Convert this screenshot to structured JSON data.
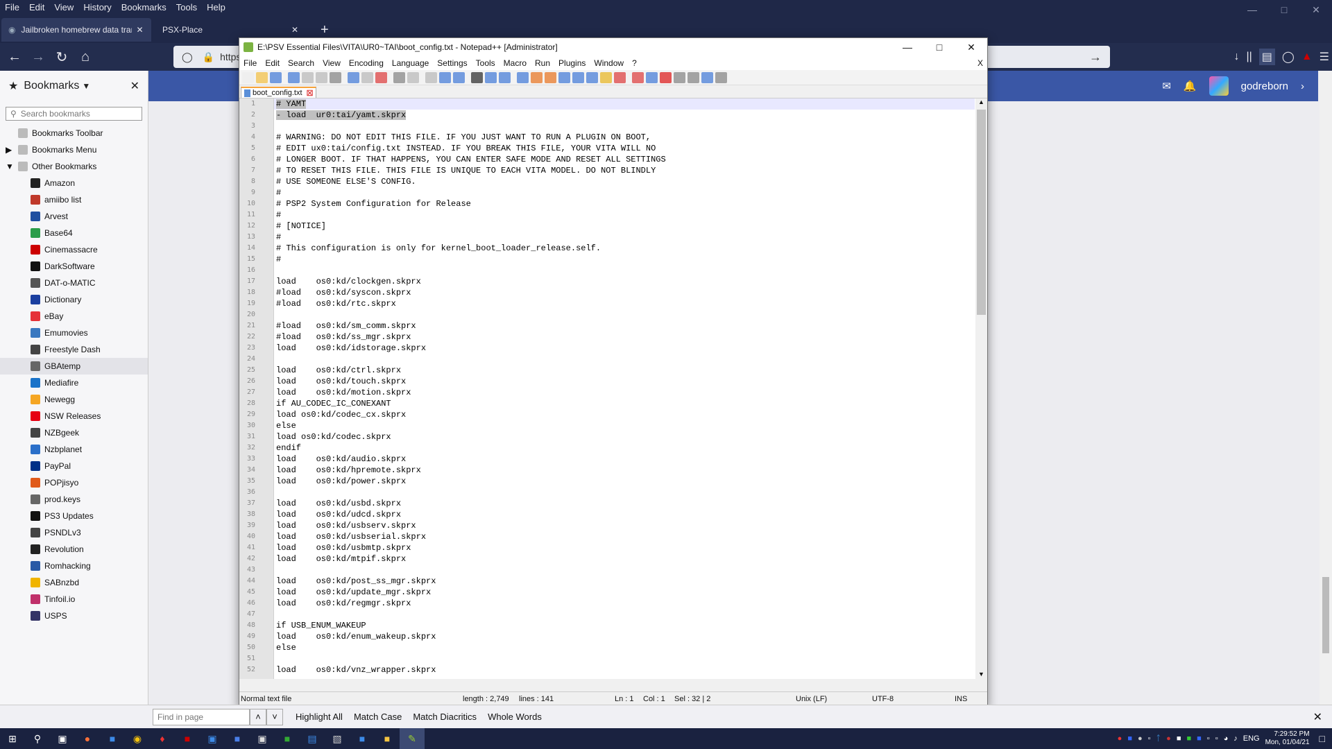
{
  "firefox": {
    "menu": [
      "File",
      "Edit",
      "View",
      "History",
      "Bookmarks",
      "Tools",
      "Help"
    ],
    "tabs": [
      {
        "title": "Jailbroken homebrew data tran",
        "active": true
      },
      {
        "title": "PSX-Place",
        "active": false
      }
    ],
    "url": "https",
    "findbar": {
      "placeholder": "Find in page",
      "highlight_all": "Highlight All",
      "match_case": "Match Case",
      "match_diacritics": "Match Diacritics",
      "whole_words": "Whole Words"
    },
    "site": {
      "username": "godreborn",
      "accent": "#3a57a6"
    }
  },
  "sidebar": {
    "title": "Bookmarks",
    "search_placeholder": "Search bookmarks",
    "folders": [
      "Bookmarks Toolbar",
      "Bookmarks Menu",
      "Other Bookmarks"
    ],
    "items": [
      {
        "label": "Amazon",
        "icon": "amazon-icon",
        "color": "#222"
      },
      {
        "label": "amiibo list",
        "icon": "amiibo-icon",
        "color": "#c0392b"
      },
      {
        "label": "Arvest",
        "icon": "arvest-icon",
        "color": "#1f4fa0"
      },
      {
        "label": "Base64",
        "icon": "base64-icon",
        "color": "#2a9d4a"
      },
      {
        "label": "Cinemassacre",
        "icon": "cinemassacre-icon",
        "color": "#c00"
      },
      {
        "label": "DarkSoftware",
        "icon": "darksoftware-icon",
        "color": "#111"
      },
      {
        "label": "DAT-o-MATIC",
        "icon": "datomatic-icon",
        "color": "#555"
      },
      {
        "label": "Dictionary",
        "icon": "dictionary-icon",
        "color": "#1b3fa0"
      },
      {
        "label": "eBay",
        "icon": "ebay-icon",
        "color": "#e53238"
      },
      {
        "label": "Emumovies",
        "icon": "emumovies-icon",
        "color": "#3a78c0"
      },
      {
        "label": "Freestyle Dash",
        "icon": "globe-icon",
        "color": "#444"
      },
      {
        "label": "GBAtemp",
        "icon": "gbatemp-icon",
        "color": "#666"
      },
      {
        "label": "Mediafire",
        "icon": "mediafire-icon",
        "color": "#1a73c9"
      },
      {
        "label": "Newegg",
        "icon": "newegg-icon",
        "color": "#f5a623"
      },
      {
        "label": "NSW Releases",
        "icon": "nsw-icon",
        "color": "#e60012"
      },
      {
        "label": "NZBgeek",
        "icon": "nzbgeek-icon",
        "color": "#444"
      },
      {
        "label": "Nzbplanet",
        "icon": "nzbplanet-icon",
        "color": "#2a6fc9"
      },
      {
        "label": "PayPal",
        "icon": "paypal-icon",
        "color": "#003087"
      },
      {
        "label": "POPjisyo",
        "icon": "popjisyo-icon",
        "color": "#e05a1a"
      },
      {
        "label": "prod.keys",
        "icon": "grid-icon",
        "color": "#666"
      },
      {
        "label": "PS3 Updates",
        "icon": "ps3-icon",
        "color": "#111"
      },
      {
        "label": "PSNDLv3",
        "icon": "globe-icon",
        "color": "#444"
      },
      {
        "label": "Revolution",
        "icon": "revolution-icon",
        "color": "#222"
      },
      {
        "label": "Romhacking",
        "icon": "romhacking-icon",
        "color": "#2a5aa6"
      },
      {
        "label": "SABnzbd",
        "icon": "sabnzbd-icon",
        "color": "#f0b400"
      },
      {
        "label": "Tinfoil.io",
        "icon": "tinfoil-icon",
        "color": "#c0306a"
      },
      {
        "label": "USPS",
        "icon": "usps-icon",
        "color": "#333366"
      }
    ]
  },
  "npp": {
    "title": "E:\\PSV Essential Files\\VITA\\UR0~TAI\\boot_config.txt - Notepad++ [Administrator]",
    "menu": [
      "File",
      "Edit",
      "Search",
      "View",
      "Encoding",
      "Language",
      "Settings",
      "Tools",
      "Macro",
      "Run",
      "Plugins",
      "Window",
      "?"
    ],
    "tab": "boot_config.txt",
    "close_x": "X",
    "lines": [
      "# YAMT",
      "- load  ur0:tai/yamt.skprx",
      "",
      "# WARNING: DO NOT EDIT THIS FILE. IF YOU JUST WANT TO RUN A PLUGIN ON BOOT,",
      "# EDIT ux0:tai/config.txt INSTEAD. IF YOU BREAK THIS FILE, YOUR VITA WILL NO",
      "# LONGER BOOT. IF THAT HAPPENS, YOU CAN ENTER SAFE MODE AND RESET ALL SETTINGS",
      "# TO RESET THIS FILE. THIS FILE IS UNIQUE TO EACH VITA MODEL. DO NOT BLINDLY",
      "# USE SOMEONE ELSE'S CONFIG.",
      "#",
      "# PSP2 System Configuration for Release",
      "#",
      "# [NOTICE]",
      "#",
      "# This configuration is only for kernel_boot_loader_release.self.",
      "#",
      "",
      "load    os0:kd/clockgen.skprx",
      "#load   os0:kd/syscon.skprx",
      "#load   os0:kd/rtc.skprx",
      "",
      "#load   os0:kd/sm_comm.skprx",
      "#load   os0:kd/ss_mgr.skprx",
      "load    os0:kd/idstorage.skprx",
      "",
      "load    os0:kd/ctrl.skprx",
      "load    os0:kd/touch.skprx",
      "load    os0:kd/motion.skprx",
      "if AU_CODEC_IC_CONEXANT",
      "load os0:kd/codec_cx.skprx",
      "else",
      "load os0:kd/codec.skprx",
      "endif",
      "load    os0:kd/audio.skprx",
      "load    os0:kd/hpremote.skprx",
      "load    os0:kd/power.skprx",
      "",
      "load    os0:kd/usbd.skprx",
      "load    os0:kd/udcd.skprx",
      "load    os0:kd/usbserv.skprx",
      "load    os0:kd/usbserial.skprx",
      "load    os0:kd/usbmtp.skprx",
      "load    os0:kd/mtpif.skprx",
      "",
      "load    os0:kd/post_ss_mgr.skprx",
      "load    os0:kd/update_mgr.skprx",
      "load    os0:kd/regmgr.skprx",
      "",
      "if USB_ENUM_WAKEUP",
      "load    os0:kd/enum_wakeup.skprx",
      "else",
      "",
      "load    os0:kd/vnz_wrapper.skprx"
    ],
    "status": {
      "type": "Normal text file",
      "length": "length : 2,749",
      "lines": "lines : 141",
      "ln": "Ln : 1",
      "col": "Col : 1",
      "sel": "Sel : 32 | 2",
      "eol": "Unix (LF)",
      "encoding": "UTF-8",
      "mode": "INS"
    }
  },
  "taskbar": {
    "lang": "ENG",
    "time": "7:29:52 PM",
    "date": "Mon, 01/04/21"
  }
}
